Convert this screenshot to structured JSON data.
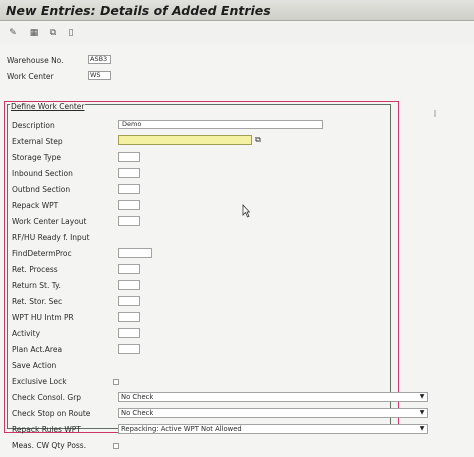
{
  "window": {
    "title": "New Entries: Details of Added Entries"
  },
  "toolbar": {
    "icons": [
      "display-change-icon",
      "table-icon",
      "copy-icon",
      "document-icon"
    ]
  },
  "header": {
    "warehouse_label": "Warehouse No.",
    "warehouse_value": "ASB3",
    "workcenter_label": "Work Center",
    "workcenter_value": "WS"
  },
  "group": {
    "title": "Define Work Center",
    "fields": {
      "description": {
        "label": "Description",
        "value": "Demo"
      },
      "external_step": {
        "label": "External Step",
        "value": ""
      },
      "storage_type": {
        "label": "Storage Type",
        "value": ""
      },
      "inbound_section": {
        "label": "Inbound Section",
        "value": ""
      },
      "outbound_section": {
        "label": "Outbnd Section",
        "value": ""
      },
      "repack_wpt": {
        "label": "Repack WPT",
        "value": ""
      },
      "work_center_layout": {
        "label": "Work Center Layout",
        "value": ""
      },
      "rfhu_ready_input": {
        "label": "RF/HU Ready f. Input"
      },
      "find_determ_proc": {
        "label": "FindDetermProc",
        "value": ""
      },
      "ret_process": {
        "label": "Ret. Process",
        "value": ""
      },
      "return_st_ty": {
        "label": "Return St. Ty.",
        "value": ""
      },
      "ret_stor_sec": {
        "label": "Ret. Stor. Sec",
        "value": ""
      },
      "wpt_hu_intm_pr": {
        "label": "WPT HU Intm PR",
        "value": ""
      },
      "activity": {
        "label": "Activity",
        "value": ""
      },
      "plan_act_area": {
        "label": "Plan Act.Area",
        "value": ""
      },
      "save_action": {
        "label": "Save Action"
      },
      "exclusive_lock": {
        "label": "Exclusive Lock"
      },
      "check_consol_grp": {
        "label": "Check Consol. Grp",
        "value": "No Check"
      },
      "check_stop_on_route": {
        "label": "Check Stop on Route",
        "value": "No Check"
      },
      "repack_rules_wpt": {
        "label": "Repack Rules WPT",
        "value": "Repacking: Active WPT Not Allowed"
      }
    }
  },
  "footer": {
    "meas_cw_qty_poss": {
      "label": "Meas. CW Qty Poss."
    }
  }
}
